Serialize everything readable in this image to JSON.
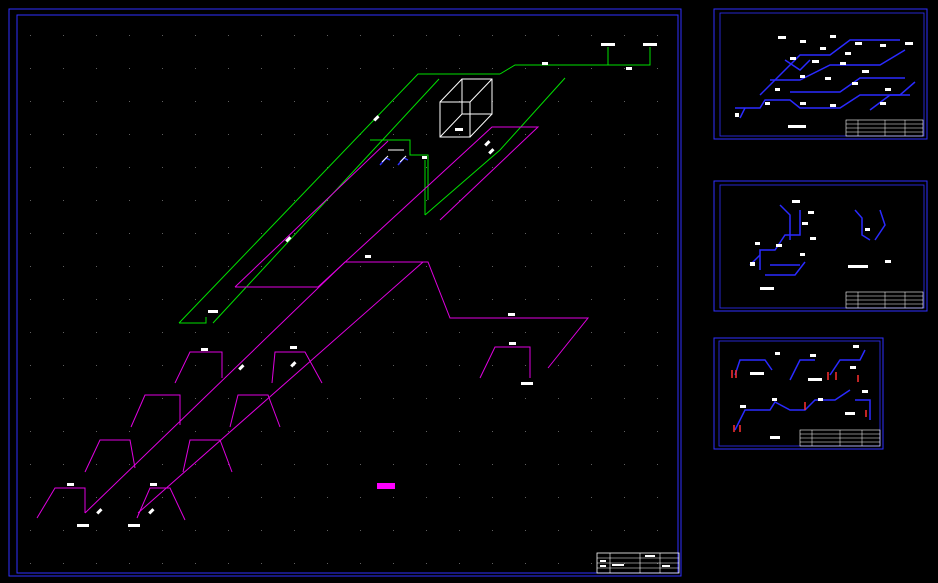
{
  "canvas": {
    "background": "#000000"
  },
  "colors": {
    "frame": "#3030ff",
    "supply_pipe": "#00e000",
    "drain_pipe": "#e000e0",
    "equipment": "#ffffff",
    "label": "#ffffff",
    "grid_dot": "#606060",
    "sheet_pipe": "#2a2aff",
    "fixture": "#ff3030"
  },
  "main_sheet": {
    "name": "main-drawing-sheet",
    "title_text": "",
    "title_block": {
      "icon": "title-block-table"
    }
  },
  "sheets": [
    {
      "name": "sheet-thumbnail-1",
      "title_text": ""
    },
    {
      "name": "sheet-thumbnail-2",
      "title_text": ""
    },
    {
      "name": "sheet-thumbnail-3",
      "title_text": ""
    }
  ],
  "icons": {
    "water_tank": "tank-box-icon",
    "fixtures": "sink-fixture-icon",
    "title_block": "table-grid-icon"
  }
}
